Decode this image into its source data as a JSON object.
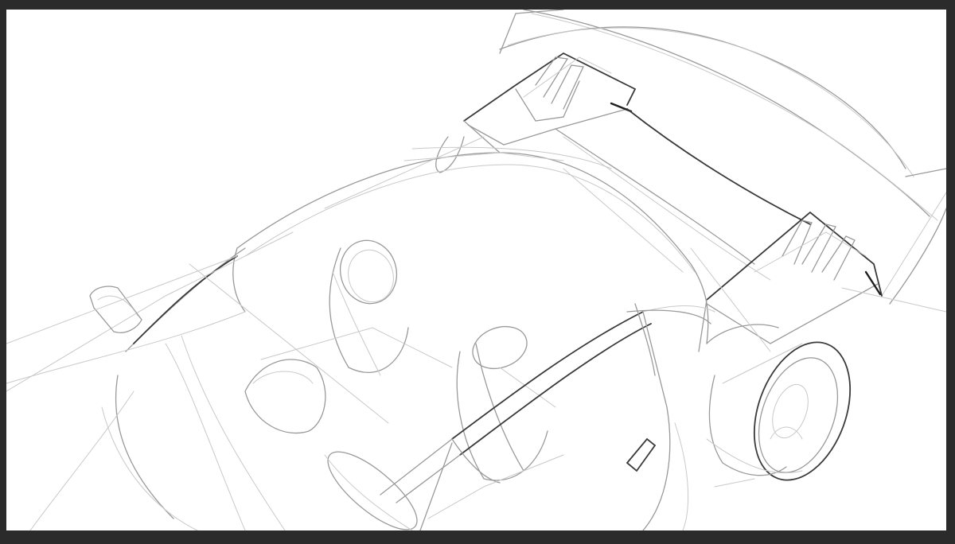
{
  "app": {
    "frame_color": "#2b2b2b",
    "canvas_color": "#ffffff"
  },
  "canvas": {
    "content": "pencil-sketch-car",
    "stroke_colors": [
      "#c9c9c9",
      "#9a9a9a",
      "#3a3a3a",
      "#1e1e1e"
    ]
  }
}
